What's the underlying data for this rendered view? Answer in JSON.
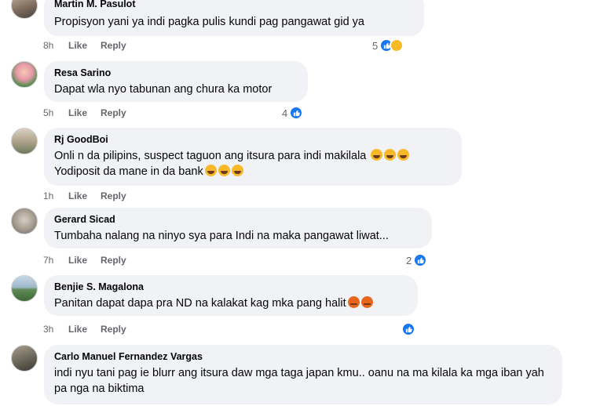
{
  "comments": [
    {
      "author": "Martin M. Pasulot",
      "text": "Propisyon yani ya indi pagka pulis kundi pag pangawat gid ya",
      "time": "8h",
      "like": "Like",
      "reply": "Reply",
      "reaction_count": "5"
    },
    {
      "author": "Resa Sarino",
      "text": "Dapat wla nyo tabunan ang chura ka motor",
      "time": "5h",
      "like": "Like",
      "reply": "Reply",
      "reaction_count": "4"
    },
    {
      "author": "Rj GoodBoi",
      "text_line1": "Onli n da pilipins, suspect taguon ang itsura para indi makilala",
      "text_line2": "Yodiposit da mane in da bank",
      "time": "1h",
      "like": "Like",
      "reply": "Reply"
    },
    {
      "author": "Gerard Sicad",
      "text": "Tumbaha nalang na ninyo sya para Indi na maka pangawat liwat...",
      "time": "7h",
      "like": "Like",
      "reply": "Reply",
      "reaction_count": "2"
    },
    {
      "author": "Benjie S. Magalona",
      "text": "Panitan dapat dapa pra ND na kalakat kag mka pang halit",
      "time": "3h",
      "like": "Like",
      "reply": "Reply"
    },
    {
      "author": "Carlo Manuel Fernandez Vargas",
      "text": "indi nyu tani pag ie blurr ang itsura daw mga taga japan kmu.. oanu na ma kilala ka mga iban yah pa nga na biktima"
    }
  ],
  "colors": {
    "bubble": "#f0f2f5",
    "like_blue": "#1877f2",
    "meta_gray": "#65676b",
    "haha_yellow": "#f7b928",
    "angry_orange": "#e9710f"
  }
}
